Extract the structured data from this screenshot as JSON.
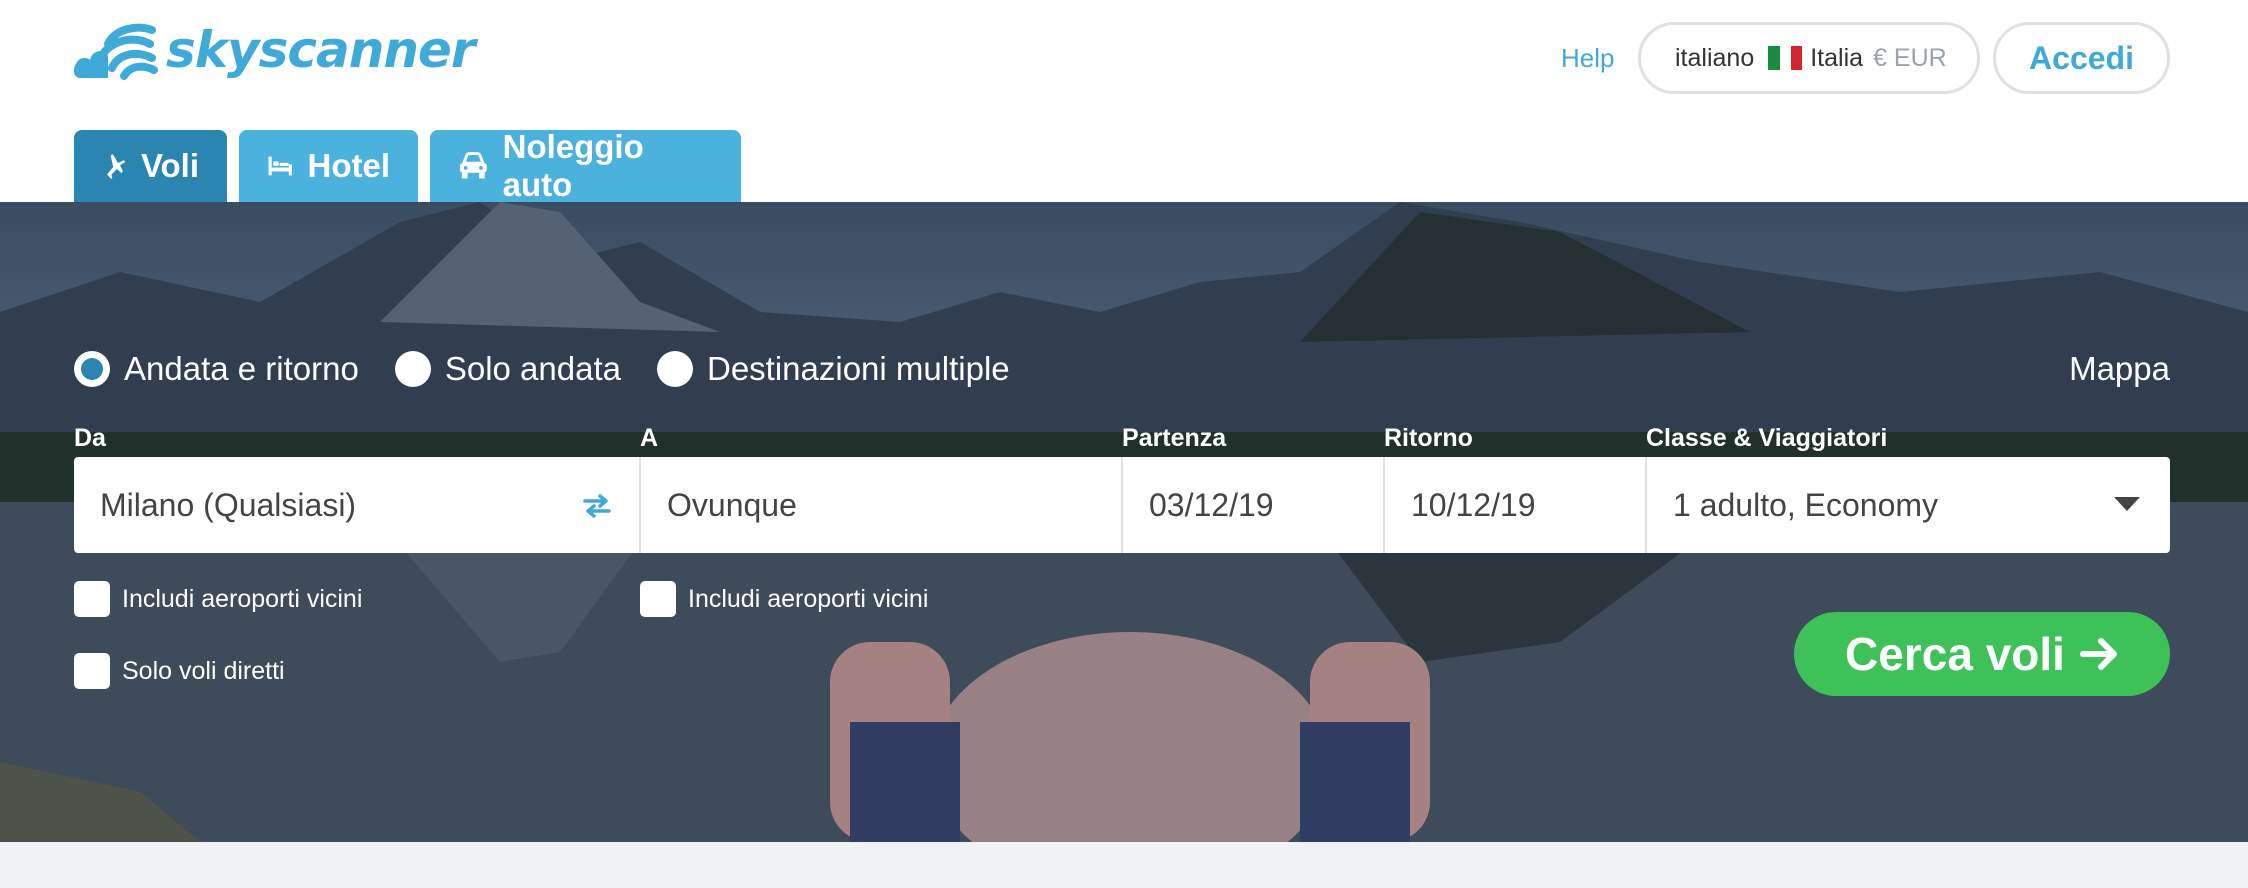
{
  "brand": {
    "name": "skyscanner",
    "color": "#3fa9d8"
  },
  "header": {
    "help": "Help",
    "locale": {
      "language": "italiano",
      "country": "Italia",
      "currency": "€ EUR"
    },
    "login": "Accedi"
  },
  "tabs": [
    {
      "label": "Voli",
      "icon": "plane-icon",
      "active": true
    },
    {
      "label": "Hotel",
      "icon": "bed-icon",
      "active": false
    },
    {
      "label": "Noleggio auto",
      "icon": "car-icon",
      "active": false
    }
  ],
  "search": {
    "trip_types": [
      {
        "label": "Andata e ritorno",
        "checked": true
      },
      {
        "label": "Solo andata",
        "checked": false
      },
      {
        "label": "Destinazioni multiple",
        "checked": false
      }
    ],
    "map": "Mappa",
    "fields": {
      "from": {
        "label": "Da",
        "value": "Milano (Qualsiasi)"
      },
      "to": {
        "label": "A",
        "value": "Ovunque"
      },
      "depart": {
        "label": "Partenza",
        "value": "03/12/19"
      },
      "return": {
        "label": "Ritorno",
        "value": "10/12/19"
      },
      "class": {
        "label": "Classe & Viaggiatori",
        "value": "1 adulto, Economy"
      }
    },
    "checkboxes": {
      "nearby_from": "Includi aeroporti vicini",
      "nearby_to": "Includi aeroporti vicini",
      "direct_only": "Solo voli diretti"
    },
    "submit": "Cerca voli",
    "submit_color": "#3fc15a"
  }
}
